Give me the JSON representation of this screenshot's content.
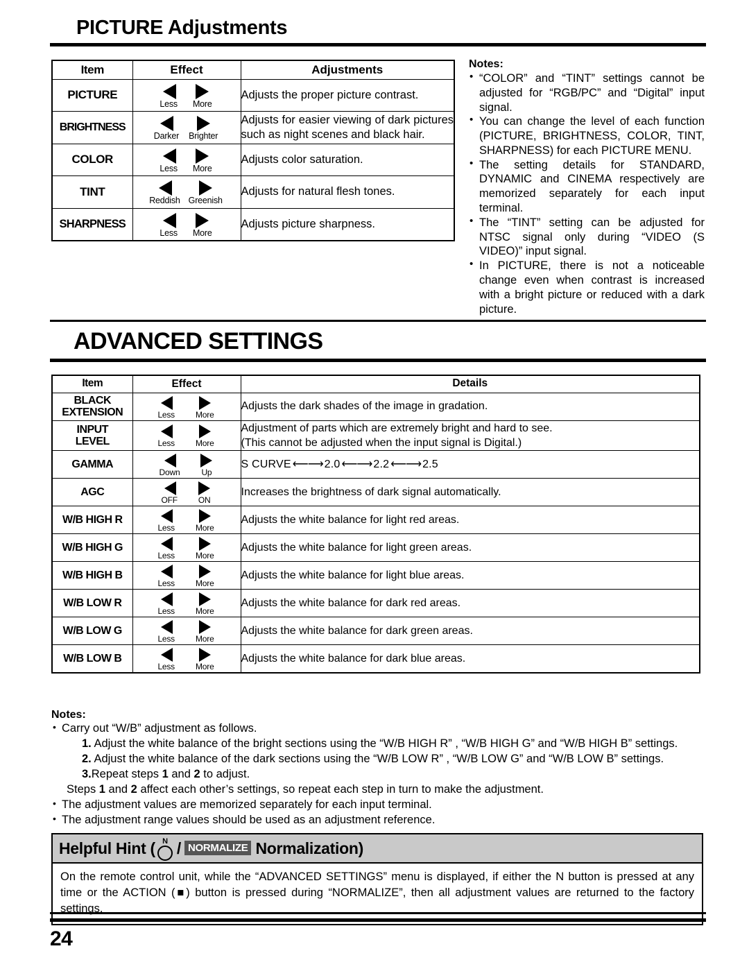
{
  "section1": {
    "title": "PICTURE Adjustments",
    "table": {
      "headers": [
        "Item",
        "Effect",
        "Adjustments"
      ],
      "rows": [
        {
          "item": "PICTURE",
          "left_label": "Less",
          "right_label": "More",
          "desc": "Adjusts the proper picture contrast."
        },
        {
          "item": "BRIGHTNESS",
          "left_label": "Darker",
          "right_label": "Brighter",
          "desc": "Adjusts for easier viewing of dark pictures such as night scenes and black hair."
        },
        {
          "item": "COLOR",
          "left_label": "Less",
          "right_label": "More",
          "desc": "Adjusts color saturation."
        },
        {
          "item": "TINT",
          "left_label": "Reddish",
          "right_label": "Greenish",
          "desc": "Adjusts for natural flesh tones."
        },
        {
          "item": "SHARPNESS",
          "left_label": "Less",
          "right_label": "More",
          "desc": "Adjusts picture sharpness."
        }
      ]
    },
    "notes": {
      "heading": "Notes:",
      "items": [
        "“COLOR” and “TINT” settings cannot be adjusted for “RGB/PC” and “Digital” input signal.",
        "You can change the level of each function (PICTURE, BRIGHTNESS, COLOR, TINT, SHARPNESS) for each PICTURE MENU.",
        "The setting details for STANDARD, DYNAMIC and CINEMA respectively are memorized separately for each input terminal.",
        "The “TINT” setting can be adjusted for NTSC signal only during “VIDEO (S VIDEO)” input signal.",
        "In PICTURE, there is not a noticeable change even when contrast is increased with a bright picture or reduced with a dark picture."
      ]
    }
  },
  "section2": {
    "title": "ADVANCED SETTINGS",
    "table": {
      "headers": [
        "Item",
        "Effect",
        "Details"
      ],
      "rows": [
        {
          "item": "BLACK\nEXTENSION",
          "left_label": "Less",
          "right_label": "More",
          "desc": "Adjusts the dark shades of the image in gradation."
        },
        {
          "item": "INPUT\nLEVEL",
          "left_label": "Less",
          "right_label": "More",
          "desc": "Adjustment of parts which are extremely bright and hard to see.\n(This cannot be adjusted when the input signal is Digital.)"
        },
        {
          "item": "GAMMA",
          "left_label": "Down",
          "right_label": "Up",
          "desc": ""
        },
        {
          "item": "AGC",
          "left_label": "OFF",
          "right_label": "ON",
          "desc": "Increases the brightness of dark signal automatically."
        },
        {
          "item": "W/B HIGH R",
          "left_label": "Less",
          "right_label": "More",
          "desc": "Adjusts the white balance for light red areas."
        },
        {
          "item": "W/B HIGH G",
          "left_label": "Less",
          "right_label": "More",
          "desc": "Adjusts the white balance for light green areas."
        },
        {
          "item": "W/B HIGH B",
          "left_label": "Less",
          "right_label": "More",
          "desc": "Adjusts the white balance for light blue areas."
        },
        {
          "item": "W/B LOW R",
          "left_label": "Less",
          "right_label": "More",
          "desc": "Adjusts the white balance for dark red areas."
        },
        {
          "item": "W/B LOW G",
          "left_label": "Less",
          "right_label": "More",
          "desc": "Adjusts the white balance for dark green areas."
        },
        {
          "item": "W/B LOW B",
          "left_label": "Less",
          "right_label": "More",
          "desc": "Adjusts the white balance for dark blue areas."
        }
      ],
      "gamma_sequence": {
        "label": "S CURVE",
        "arrow": "⟵⟶",
        "values": [
          "2.0",
          "2.2",
          "2.5"
        ]
      }
    },
    "notes": {
      "heading": "Notes:",
      "bullet1": "Carry out “W/B” adjustment as follows.",
      "step1_num": "1.",
      "step1": "Adjust the white balance of the bright sections using the “W/B HIGH R” , “W/B HIGH G” and “W/B HIGH B” settings.",
      "step2_num": "2.",
      "step2": "Adjust the white balance of the dark sections using the “W/B LOW R” , “W/B LOW G” and “W/B LOW B” settings.",
      "step3_num": "3.",
      "step3_pre": "Repeat steps ",
      "step3_a": "1",
      "step3_mid": " and ",
      "step3_b": "2",
      "step3_post": " to adjust.",
      "cont_pre": "Steps ",
      "cont_a": "1",
      "cont_mid": " and ",
      "cont_b": "2",
      "cont_post": " affect each other’s settings, so repeat each step in turn to make the adjustment.",
      "bullet2": "The adjustment values are memorized separately for each input terminal.",
      "bullet3": "The adjustment range values should be used as an adjustment reference."
    }
  },
  "hint": {
    "title_pre": "Helpful Hint (",
    "n_label": "N",
    "slash": "/",
    "badge": "NORMALIZE",
    "title_post": "Normalization)",
    "body": "On the remote control unit, while the “ADVANCED SETTINGS” menu is displayed, if either the N button is pressed at any time or the ACTION (■) button is pressed during “NORMALIZE”, then all adjustment values are returned to the factory settings."
  },
  "footer": {
    "page_number": "24"
  }
}
